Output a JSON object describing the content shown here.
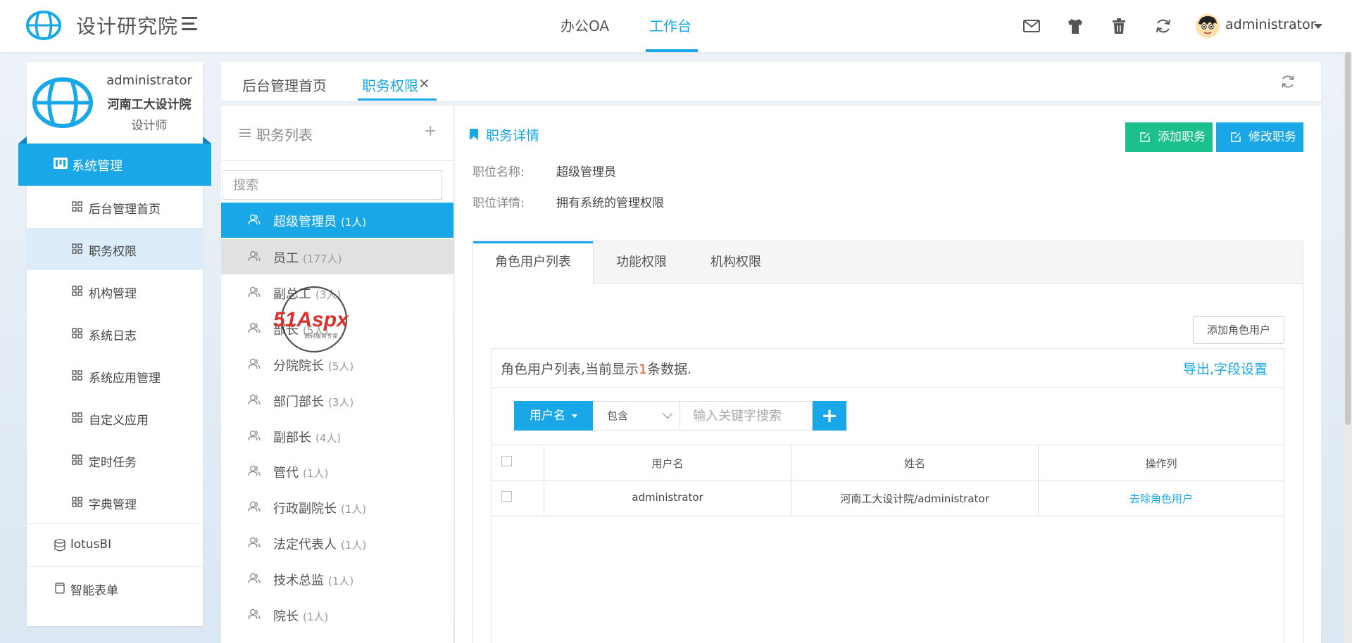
{
  "header": {
    "brand": "设计研究院",
    "nav": [
      "办公OA",
      "工作台"
    ],
    "active_nav": "工作台",
    "icons": [
      "mail-icon",
      "shirt-icon",
      "trash-icon",
      "refresh-icon"
    ],
    "user": "administrator"
  },
  "sidebar": {
    "profile": {
      "name": "administrator",
      "org": "河南工大设计院",
      "role": "设计师"
    },
    "group": "系统管理",
    "items": [
      "后台管理首页",
      "职务权限",
      "机构管理",
      "系统日志",
      "系统应用管理",
      "自定义应用",
      "定时任务",
      "字典管理"
    ],
    "active_item": "职务权限",
    "lower": [
      "lotusBI",
      "智能表单"
    ]
  },
  "page_tabs": {
    "items": [
      "后台管理首页",
      "职务权限"
    ],
    "active": "职务权限",
    "close": "×"
  },
  "role_list": {
    "title": "职务列表",
    "add": "+",
    "search_placeholder": "搜索",
    "items": [
      {
        "name": "超级管理员",
        "count": "(1人)"
      },
      {
        "name": "员工",
        "count": "(177人)"
      },
      {
        "name": "副总工",
        "count": "(3人)"
      },
      {
        "name": "部长",
        "count": "(5人)"
      },
      {
        "name": "分院院长",
        "count": "(5人)"
      },
      {
        "name": "部门部长",
        "count": "(3人)"
      },
      {
        "name": "副部长",
        "count": "(4人)"
      },
      {
        "name": "管代",
        "count": "(1人)"
      },
      {
        "name": "行政副院长",
        "count": "(1人)"
      },
      {
        "name": "法定代表人",
        "count": "(1人)"
      },
      {
        "name": "技术总监",
        "count": "(1人)"
      },
      {
        "name": "院长",
        "count": "(1人)"
      }
    ]
  },
  "detail": {
    "title": "职务详情",
    "add_button": "添加职务",
    "edit_button": "修改职务",
    "name_label": "职位名称:",
    "name_value": "超级管理员",
    "desc_label": "职位详情:",
    "desc_value": "拥有系统的管理权限",
    "tabs": [
      "角色用户列表",
      "功能权限",
      "机构权限"
    ],
    "active_tab": "角色用户列表",
    "add_role_user": "添加角色用户",
    "caption_prefix": "角色用户列表,当前显示",
    "caption_count": "1",
    "caption_suffix": "条数据.",
    "export": "导出,字段设置",
    "filter": {
      "field": "用户名",
      "op": "包含",
      "placeholder": "输入关键字搜索",
      "go": "+"
    },
    "columns": [
      "用户名",
      "姓名",
      "操作列"
    ],
    "rows": [
      {
        "username": "administrator",
        "fullname": "河南工大设计院/administrator",
        "action": "去除角色用户"
      }
    ]
  },
  "watermark": {
    "text": "51Aspx",
    "sub": "源码服务专家"
  },
  "colors": {
    "accent": "#1aa7e8",
    "success": "#1cc08c",
    "count": "#e8522a"
  }
}
